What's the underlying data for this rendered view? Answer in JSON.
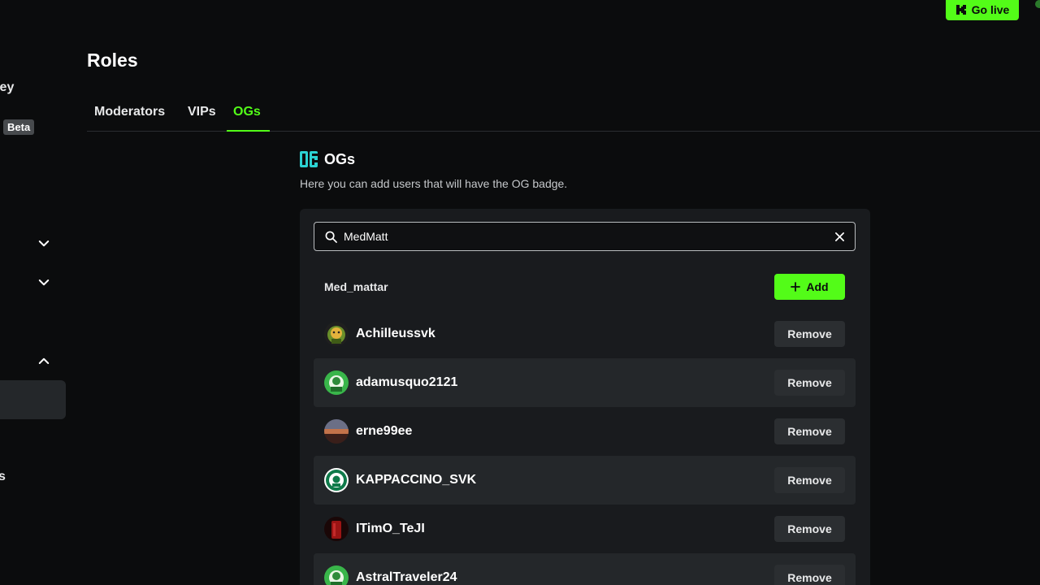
{
  "sidebar": {
    "partial_label_top": "Key",
    "beta_badge": "Beta",
    "partial_label_bottom": "s",
    "chevrons": [
      "chevron-down",
      "chevron-down",
      "chevron-up"
    ]
  },
  "header": {
    "go_live_label": "Go live"
  },
  "page": {
    "title": "Roles"
  },
  "tabs": [
    {
      "label": "Moderators",
      "active": false
    },
    {
      "label": "VIPs",
      "active": false
    },
    {
      "label": "OGs",
      "active": true
    }
  ],
  "section": {
    "title": "OGs",
    "description": "Here you can add users that will have the OG badge."
  },
  "search": {
    "value": "MedMatt",
    "placeholder": ""
  },
  "search_result": {
    "username": "Med_mattar",
    "add_label": "Add"
  },
  "users": [
    {
      "username": "Achilleussvk",
      "remove_label": "Remove",
      "avatar": "achilleus-avatar"
    },
    {
      "username": "adamusquo2121",
      "remove_label": "Remove",
      "avatar": "adamusquo-avatar"
    },
    {
      "username": "erne99ee",
      "remove_label": "Remove",
      "avatar": "erne-avatar"
    },
    {
      "username": "KAPPACCINO_SVK",
      "remove_label": "Remove",
      "avatar": "kappaccino-avatar"
    },
    {
      "username": "ITimO_TeJI",
      "remove_label": "Remove",
      "avatar": "itimo-avatar"
    },
    {
      "username": "AstralTraveler24",
      "remove_label": "Remove",
      "avatar": "astral-avatar"
    }
  ],
  "colors": {
    "accent": "#53fc18",
    "background": "#0b0c0d",
    "panel": "#191b1e",
    "row_alt": "#24272a"
  }
}
